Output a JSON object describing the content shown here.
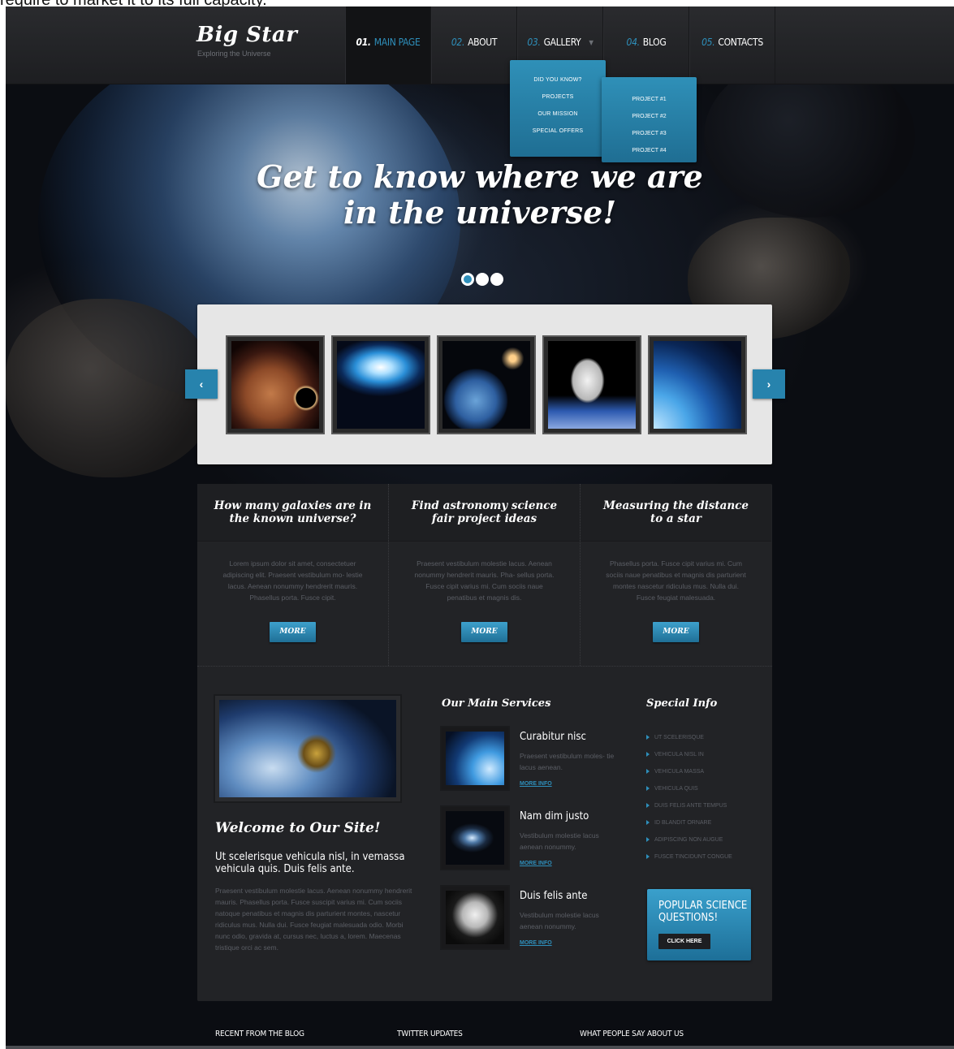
{
  "top_caption": "require to market it to its full capacity.",
  "header": {
    "logo": "Big Star",
    "tagline": "Exploring the Universe",
    "nav": [
      {
        "num": "01.",
        "label": "MAIN PAGE"
      },
      {
        "num": "02.",
        "label": "ABOUT"
      },
      {
        "num": "03.",
        "label": "GALLERY"
      },
      {
        "num": "04.",
        "label": "BLOG"
      },
      {
        "num": "05.",
        "label": "CONTACTS"
      }
    ],
    "dropdown": [
      "DID YOU KNOW?",
      "PROJECTS",
      "OUR MISSION",
      "SPECIAL OFFERS"
    ],
    "subdropdown": [
      "PROJECT #1",
      "PROJECT #2",
      "PROJECT #3",
      "PROJECT #4"
    ]
  },
  "hero": {
    "line1": "Get to know where we are",
    "line2": "in the universe!"
  },
  "carousel": {
    "prev": "‹",
    "next": "›",
    "images": [
      "planet-icon",
      "earth-glow-icon",
      "earth-icon",
      "astronaut-icon",
      "earth-horizon-icon"
    ]
  },
  "columns": [
    {
      "title": "How many galaxies are in the known universe?",
      "text": "Lorem ipsum dolor sit amet, consectetuer adipiscing elit. Praesent vestibulum mo- lestie lacus. Aenean nonummy hendrerit mauris. Phasellus porta. Fusce cipit.",
      "button": "MORE"
    },
    {
      "title": "Find astronomy science fair project ideas",
      "text": "Praesent vestibulum molestie lacus. Aenean nonummy hendrerit mauris. Pha- sellus porta. Fusce cipit varius mi. Cum sociis naue penatibus et magnis dis.",
      "button": "MORE"
    },
    {
      "title": "Measuring the distance to a star",
      "text": "Phasellus porta. Fusce cipit varius mi. Cum sociis naue penatibus et magnis dis parturient montes nascetur ridiculus mus. Nulla dui. Fusce feugiat malesuada.",
      "button": "MORE"
    }
  ],
  "welcome": {
    "title": "Welcome to Our Site!",
    "subhead": "Ut scelerisque vehicula nisl, in vemassa vehicula quis. Duis felis ante.",
    "text": "Praesent vestibulum molestie lacus. Aenean nonummy hendrerit mauris. Phasellus porta. Fusce suscipit varius mi. Cum sociis natoque penatibus et magnis dis parturient montes, nascetur ridiculus mus. Nulla dui. Fusce feugiat malesuada odio. Morbi nunc odio, gravida at, cursus nec, luctus a, lorem. Maecenas tristique orci ac sem."
  },
  "services": {
    "title": "Our Main Services",
    "items": [
      {
        "title": "Curabitur nisc",
        "desc": "Praesent vestibulum moles- tie lacus aenean.",
        "more": "MORE INFO"
      },
      {
        "title": "Nam dim justo",
        "desc": "Vestibulum molestie lacus aenean nonummy.",
        "more": "MORE INFO"
      },
      {
        "title": "Duis felis ante",
        "desc": "Vestibulum molestie lacus aenean nonummy.",
        "more": "MORE INFO"
      }
    ]
  },
  "special": {
    "title": "Special Info",
    "items": [
      "UT SCELERISQUE",
      "VEHICULA NISL IN",
      "VEHICULA MASSA",
      "VEHICULA QUIS",
      "DUIS FELIS ANTE TEMPUS",
      "ID BLANDIT ORNARE",
      "ADIPISCING NON AUGUE",
      "FUSCE TINCIDUNT CONGUE"
    ],
    "promo_text": "POPULAR SCIENCE QUESTIONS!",
    "promo_button": "CLICK HERE"
  },
  "footer": {
    "col1": "RECENT FROM THE BLOG",
    "col2": "TWITTER UPDATES",
    "col3": "WHAT PEOPLE SAY ABOUT US"
  },
  "colors": {
    "accent": "#2e8fbb",
    "panel": "#222326",
    "header": "#232427"
  }
}
